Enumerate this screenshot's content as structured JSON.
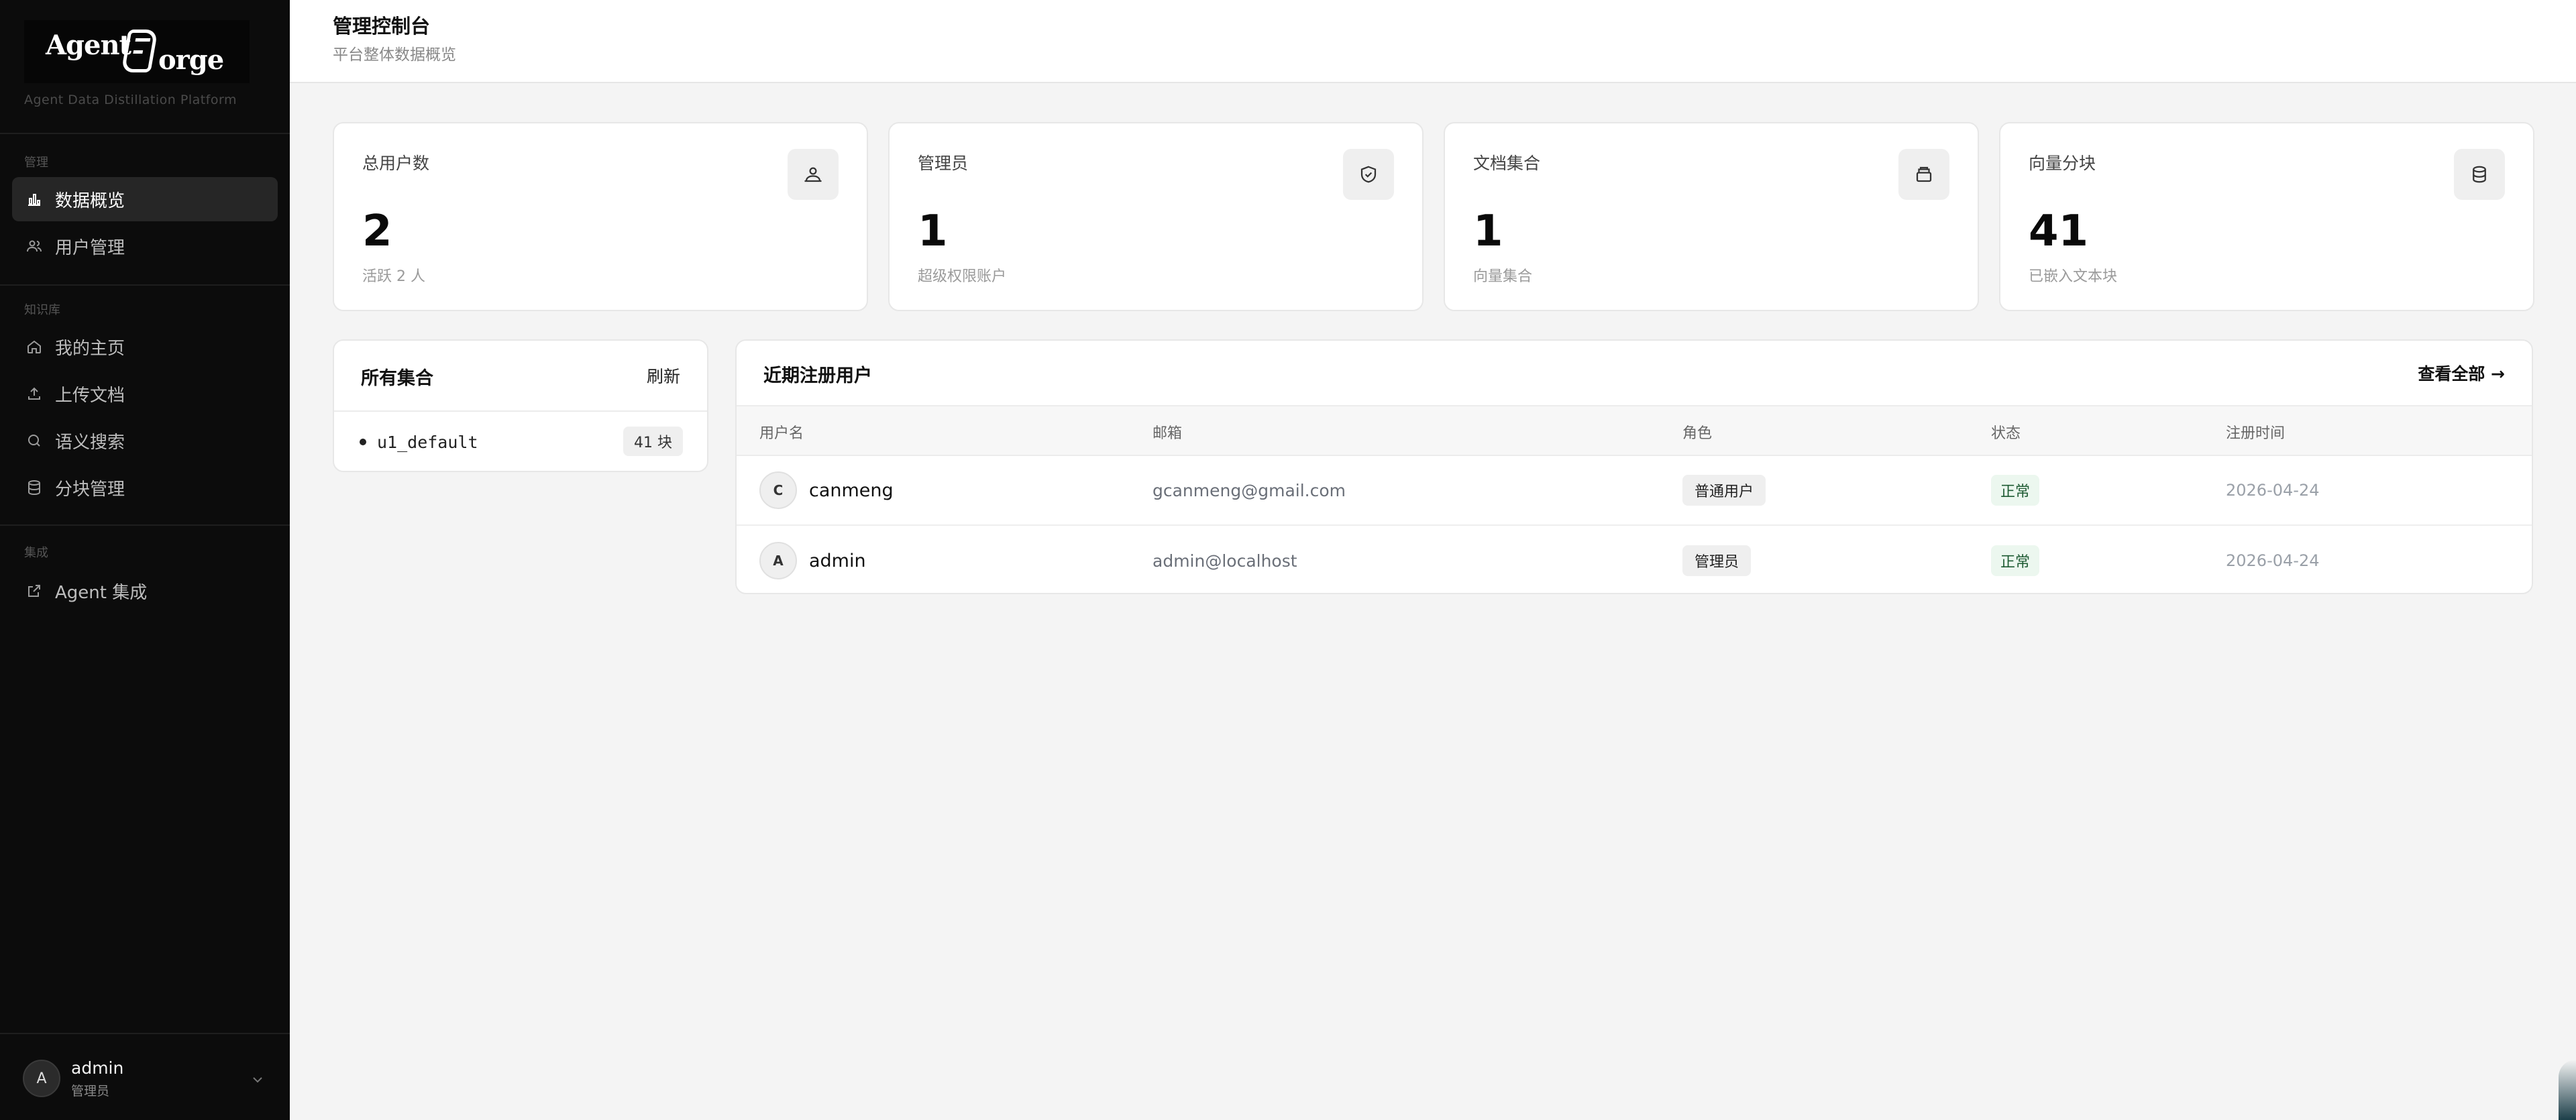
{
  "brand": {
    "word_agent": "Agent",
    "word_orge": "orge",
    "subtitle": "Agent Data Distillation Platform"
  },
  "sidebar": {
    "groups": [
      {
        "label": "管理"
      },
      {
        "label": "知识库"
      },
      {
        "label": "集成"
      }
    ],
    "items": [
      {
        "label": "数据概览",
        "icon": "bar-chart-icon",
        "active": true
      },
      {
        "label": "用户管理",
        "icon": "users-icon",
        "active": false
      },
      {
        "label": "我的主页",
        "icon": "home-icon",
        "active": false
      },
      {
        "label": "上传文档",
        "icon": "upload-icon",
        "active": false
      },
      {
        "label": "语义搜索",
        "icon": "search-icon",
        "active": false
      },
      {
        "label": "分块管理",
        "icon": "database-icon",
        "active": false
      },
      {
        "label": "Agent 集成",
        "icon": "external-link-icon",
        "active": false
      }
    ],
    "user": {
      "initial": "A",
      "name": "admin",
      "role": "管理员"
    }
  },
  "header": {
    "title": "管理控制台",
    "subtitle": "平台整体数据概览"
  },
  "stats": [
    {
      "label": "总用户数",
      "value": "2",
      "sub": "活跃 2 人",
      "icon": "users-icon"
    },
    {
      "label": "管理员",
      "value": "1",
      "sub": "超级权限账户",
      "icon": "shield-icon"
    },
    {
      "label": "文档集合",
      "value": "1",
      "sub": "向量集合",
      "icon": "archive-icon"
    },
    {
      "label": "向量分块",
      "value": "41",
      "sub": "已嵌入文本块",
      "icon": "database-icon"
    }
  ],
  "collections": {
    "title": "所有集合",
    "refresh_label": "刷新",
    "items": [
      {
        "name": "u1_default",
        "count": "41 块"
      }
    ]
  },
  "recent_users": {
    "title": "近期注册用户",
    "view_all_label": "查看全部 →",
    "columns": [
      "用户名",
      "邮箱",
      "角色",
      "状态",
      "注册时间"
    ],
    "rows": [
      {
        "initial": "C",
        "username": "canmeng",
        "email": "gcanmeng@gmail.com",
        "role": "普通用户",
        "status": "正常",
        "date": "2026-04-24"
      },
      {
        "initial": "A",
        "username": "admin",
        "email": "admin@localhost",
        "role": "管理员",
        "status": "正常",
        "date": "2026-04-24"
      }
    ]
  },
  "colors": {
    "sidebar_bg": "#0c0c0c",
    "page_bg": "#f4f4f4",
    "status_green": "#1e5b33"
  }
}
